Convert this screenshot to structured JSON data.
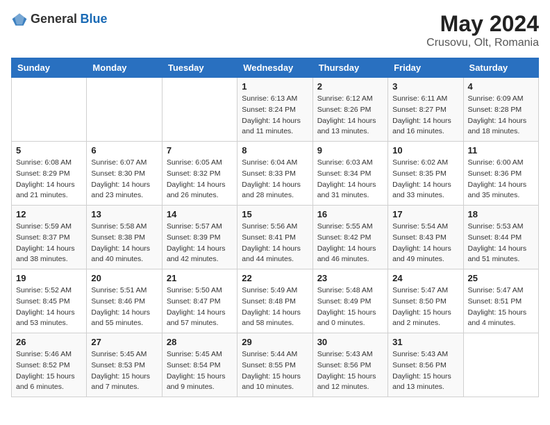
{
  "header": {
    "logo_general": "General",
    "logo_blue": "Blue",
    "month_year": "May 2024",
    "location": "Crusovu, Olt, Romania"
  },
  "columns": [
    "Sunday",
    "Monday",
    "Tuesday",
    "Wednesday",
    "Thursday",
    "Friday",
    "Saturday"
  ],
  "weeks": [
    [
      {
        "day": "",
        "sunrise": "",
        "sunset": "",
        "daylight": ""
      },
      {
        "day": "",
        "sunrise": "",
        "sunset": "",
        "daylight": ""
      },
      {
        "day": "",
        "sunrise": "",
        "sunset": "",
        "daylight": ""
      },
      {
        "day": "1",
        "sunrise": "Sunrise: 6:13 AM",
        "sunset": "Sunset: 8:24 PM",
        "daylight": "Daylight: 14 hours and 11 minutes."
      },
      {
        "day": "2",
        "sunrise": "Sunrise: 6:12 AM",
        "sunset": "Sunset: 8:26 PM",
        "daylight": "Daylight: 14 hours and 13 minutes."
      },
      {
        "day": "3",
        "sunrise": "Sunrise: 6:11 AM",
        "sunset": "Sunset: 8:27 PM",
        "daylight": "Daylight: 14 hours and 16 minutes."
      },
      {
        "day": "4",
        "sunrise": "Sunrise: 6:09 AM",
        "sunset": "Sunset: 8:28 PM",
        "daylight": "Daylight: 14 hours and 18 minutes."
      }
    ],
    [
      {
        "day": "5",
        "sunrise": "Sunrise: 6:08 AM",
        "sunset": "Sunset: 8:29 PM",
        "daylight": "Daylight: 14 hours and 21 minutes."
      },
      {
        "day": "6",
        "sunrise": "Sunrise: 6:07 AM",
        "sunset": "Sunset: 8:30 PM",
        "daylight": "Daylight: 14 hours and 23 minutes."
      },
      {
        "day": "7",
        "sunrise": "Sunrise: 6:05 AM",
        "sunset": "Sunset: 8:32 PM",
        "daylight": "Daylight: 14 hours and 26 minutes."
      },
      {
        "day": "8",
        "sunrise": "Sunrise: 6:04 AM",
        "sunset": "Sunset: 8:33 PM",
        "daylight": "Daylight: 14 hours and 28 minutes."
      },
      {
        "day": "9",
        "sunrise": "Sunrise: 6:03 AM",
        "sunset": "Sunset: 8:34 PM",
        "daylight": "Daylight: 14 hours and 31 minutes."
      },
      {
        "day": "10",
        "sunrise": "Sunrise: 6:02 AM",
        "sunset": "Sunset: 8:35 PM",
        "daylight": "Daylight: 14 hours and 33 minutes."
      },
      {
        "day": "11",
        "sunrise": "Sunrise: 6:00 AM",
        "sunset": "Sunset: 8:36 PM",
        "daylight": "Daylight: 14 hours and 35 minutes."
      }
    ],
    [
      {
        "day": "12",
        "sunrise": "Sunrise: 5:59 AM",
        "sunset": "Sunset: 8:37 PM",
        "daylight": "Daylight: 14 hours and 38 minutes."
      },
      {
        "day": "13",
        "sunrise": "Sunrise: 5:58 AM",
        "sunset": "Sunset: 8:38 PM",
        "daylight": "Daylight: 14 hours and 40 minutes."
      },
      {
        "day": "14",
        "sunrise": "Sunrise: 5:57 AM",
        "sunset": "Sunset: 8:39 PM",
        "daylight": "Daylight: 14 hours and 42 minutes."
      },
      {
        "day": "15",
        "sunrise": "Sunrise: 5:56 AM",
        "sunset": "Sunset: 8:41 PM",
        "daylight": "Daylight: 14 hours and 44 minutes."
      },
      {
        "day": "16",
        "sunrise": "Sunrise: 5:55 AM",
        "sunset": "Sunset: 8:42 PM",
        "daylight": "Daylight: 14 hours and 46 minutes."
      },
      {
        "day": "17",
        "sunrise": "Sunrise: 5:54 AM",
        "sunset": "Sunset: 8:43 PM",
        "daylight": "Daylight: 14 hours and 49 minutes."
      },
      {
        "day": "18",
        "sunrise": "Sunrise: 5:53 AM",
        "sunset": "Sunset: 8:44 PM",
        "daylight": "Daylight: 14 hours and 51 minutes."
      }
    ],
    [
      {
        "day": "19",
        "sunrise": "Sunrise: 5:52 AM",
        "sunset": "Sunset: 8:45 PM",
        "daylight": "Daylight: 14 hours and 53 minutes."
      },
      {
        "day": "20",
        "sunrise": "Sunrise: 5:51 AM",
        "sunset": "Sunset: 8:46 PM",
        "daylight": "Daylight: 14 hours and 55 minutes."
      },
      {
        "day": "21",
        "sunrise": "Sunrise: 5:50 AM",
        "sunset": "Sunset: 8:47 PM",
        "daylight": "Daylight: 14 hours and 57 minutes."
      },
      {
        "day": "22",
        "sunrise": "Sunrise: 5:49 AM",
        "sunset": "Sunset: 8:48 PM",
        "daylight": "Daylight: 14 hours and 58 minutes."
      },
      {
        "day": "23",
        "sunrise": "Sunrise: 5:48 AM",
        "sunset": "Sunset: 8:49 PM",
        "daylight": "Daylight: 15 hours and 0 minutes."
      },
      {
        "day": "24",
        "sunrise": "Sunrise: 5:47 AM",
        "sunset": "Sunset: 8:50 PM",
        "daylight": "Daylight: 15 hours and 2 minutes."
      },
      {
        "day": "25",
        "sunrise": "Sunrise: 5:47 AM",
        "sunset": "Sunset: 8:51 PM",
        "daylight": "Daylight: 15 hours and 4 minutes."
      }
    ],
    [
      {
        "day": "26",
        "sunrise": "Sunrise: 5:46 AM",
        "sunset": "Sunset: 8:52 PM",
        "daylight": "Daylight: 15 hours and 6 minutes."
      },
      {
        "day": "27",
        "sunrise": "Sunrise: 5:45 AM",
        "sunset": "Sunset: 8:53 PM",
        "daylight": "Daylight: 15 hours and 7 minutes."
      },
      {
        "day": "28",
        "sunrise": "Sunrise: 5:45 AM",
        "sunset": "Sunset: 8:54 PM",
        "daylight": "Daylight: 15 hours and 9 minutes."
      },
      {
        "day": "29",
        "sunrise": "Sunrise: 5:44 AM",
        "sunset": "Sunset: 8:55 PM",
        "daylight": "Daylight: 15 hours and 10 minutes."
      },
      {
        "day": "30",
        "sunrise": "Sunrise: 5:43 AM",
        "sunset": "Sunset: 8:56 PM",
        "daylight": "Daylight: 15 hours and 12 minutes."
      },
      {
        "day": "31",
        "sunrise": "Sunrise: 5:43 AM",
        "sunset": "Sunset: 8:56 PM",
        "daylight": "Daylight: 15 hours and 13 minutes."
      },
      {
        "day": "",
        "sunrise": "",
        "sunset": "",
        "daylight": ""
      }
    ]
  ]
}
